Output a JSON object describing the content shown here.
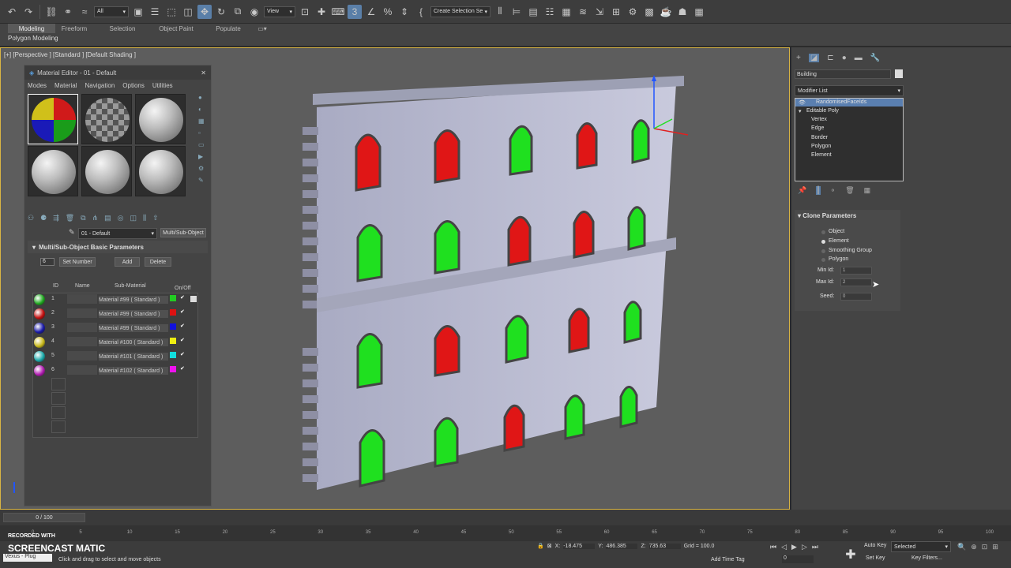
{
  "toolbar": {
    "filter_value": "All",
    "view_value": "View",
    "selection_set_placeholder": "Create Selection Se"
  },
  "ribbon": {
    "tabs": [
      "Modeling",
      "Freeform",
      "Selection",
      "Object Paint",
      "Populate"
    ],
    "sub_label": "Polygon Modeling"
  },
  "viewport": {
    "label": "[+] [Perspective ] [Standard ] [Default Shading ]"
  },
  "material_editor": {
    "title": "Material Editor - 01 - Default",
    "menu": [
      "Modes",
      "Material",
      "Navigation",
      "Options",
      "Utilities"
    ],
    "material_name": "01 - Default",
    "material_type": "Multi/Sub-Object",
    "rollout_title": "Multi/Sub-Object Basic Parameters",
    "num_materials": "6",
    "set_number_label": "Set Number",
    "add_label": "Add",
    "delete_label": "Delete",
    "headers": {
      "id": "ID",
      "name": "Name",
      "sub": "Sub-Material",
      "onoff": "On/Off"
    },
    "rows": [
      {
        "id": "1",
        "sub": "Material #99  ( Standard )",
        "color": "#22cc22",
        "sphere": "#1fa81f"
      },
      {
        "id": "2",
        "sub": "Material #99  ( Standard )",
        "color": "#dd1111",
        "sphere": "#c41010"
      },
      {
        "id": "3",
        "sub": "Material #99  ( Standard )",
        "color": "#1111dd",
        "sphere": "#1a1aa8"
      },
      {
        "id": "4",
        "sub": "Material #100  ( Standard )",
        "color": "#eeee11",
        "sphere": "#c8b81a"
      },
      {
        "id": "5",
        "sub": "Material #101  ( Standard )",
        "color": "#11dddd",
        "sphere": "#1aa8a8"
      },
      {
        "id": "6",
        "sub": "Material #102  ( Standard )",
        "color": "#ee11ee",
        "sphere": "#b01ab0"
      }
    ]
  },
  "command_panel": {
    "object_name": "Building",
    "modifier_list": "Modifier List",
    "stack": [
      "RandomisedFaceIds",
      "Editable Poly",
      "Vertex",
      "Edge",
      "Border",
      "Polygon",
      "Element"
    ],
    "clone_title": "Clone Parameters",
    "options": [
      "Object",
      "Element",
      "Smoothing Group",
      "Polygon"
    ],
    "selected_option": "Element",
    "min_id_label": "Min Id:",
    "min_id": "1",
    "max_id_label": "Max Id:",
    "max_id": "2",
    "seed_label": "Seed:",
    "seed": "0"
  },
  "timeline": {
    "frame": "0 / 100",
    "ticks": [
      "0",
      "5",
      "10",
      "15",
      "20",
      "25",
      "30",
      "35",
      "40",
      "45",
      "50",
      "55",
      "60",
      "65",
      "70",
      "75",
      "80",
      "85",
      "90",
      "95",
      "100"
    ]
  },
  "status": {
    "watermark_top": "RECORDED WITH",
    "watermark_brand": "SCREENCAST  MATIC",
    "script_label": "Vexus - Plug",
    "prompt": "Click and drag to select and move objects",
    "x_label": "X:",
    "x": "-18.475",
    "y_label": "Y:",
    "y": "486.385",
    "z_label": "Z:",
    "z": "735.63",
    "grid": "Grid = 100.0",
    "add_time_tag": "Add Time Tag",
    "auto_key": "Auto Key",
    "selected": "Selected",
    "set_key": "Set Key",
    "key_filters": "Key Filters...",
    "frame_field": "0"
  }
}
